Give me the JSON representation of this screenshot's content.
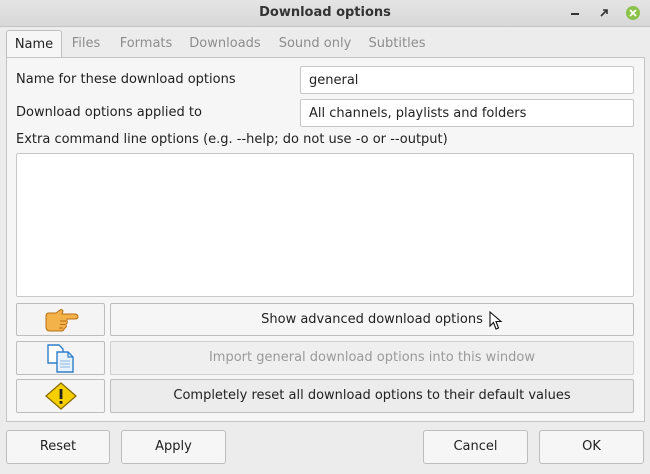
{
  "window": {
    "title": "Download options"
  },
  "tabs": [
    {
      "label": "Name",
      "active": true
    },
    {
      "label": "Files"
    },
    {
      "label": "Formats"
    },
    {
      "label": "Downloads"
    },
    {
      "label": "Sound only"
    },
    {
      "label": "Subtitles"
    }
  ],
  "form": {
    "name_label": "Name for these download options",
    "name_value": "general",
    "applied_label": "Download options applied to",
    "applied_value": "All channels, playlists and folders",
    "extra_label": "Extra command line options (e.g. --help; do not use -o or --output)",
    "extra_value": ""
  },
  "actions": {
    "show_advanced": {
      "label": "Show advanced download options",
      "icon": "pointing-hand-icon"
    },
    "import_general": {
      "label": "Import general download options into this window",
      "icon": "copy-documents-icon",
      "disabled": true
    },
    "reset_all": {
      "label": "Completely reset all download options to their default values",
      "icon": "warning-icon"
    }
  },
  "buttons": {
    "reset": "Reset",
    "apply": "Apply",
    "cancel": "Cancel",
    "ok": "OK"
  },
  "colors": {
    "close_button": "#8bc34a",
    "warning_yellow": "#f6cf00",
    "hand_orange": "#f1a12a",
    "doc_blue": "#3b8ed8"
  }
}
